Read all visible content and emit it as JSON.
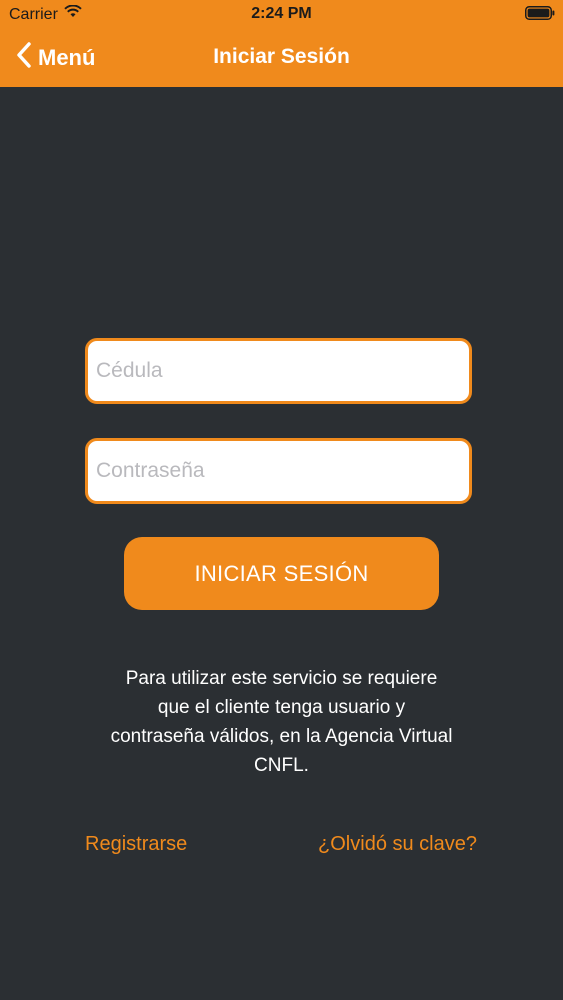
{
  "status_bar": {
    "carrier": "Carrier",
    "time": "2:24 PM",
    "wifi_icon": "wifi-icon",
    "battery_icon": "battery-icon"
  },
  "navbar": {
    "back_label": "Menú",
    "back_icon": "chevron-left-icon",
    "title": "Iniciar Sesión",
    "color": "#f08a1c"
  },
  "form": {
    "cedula": {
      "value": "",
      "placeholder": "Cédula"
    },
    "password": {
      "value": "",
      "placeholder": "Contraseña"
    },
    "submit_label": "INICIAR SESIÓN"
  },
  "info_text": "Para utilizar este servicio se requiere\nque el cliente tenga usuario y\ncontraseña válidos, en la Agencia Virtual\nCNFL.",
  "links": {
    "register": "Registrarse",
    "forgot": "¿Olvidó su clave?"
  },
  "colors": {
    "accent": "#f08a1c",
    "background": "#2b2f33",
    "text": "#ffffff"
  }
}
